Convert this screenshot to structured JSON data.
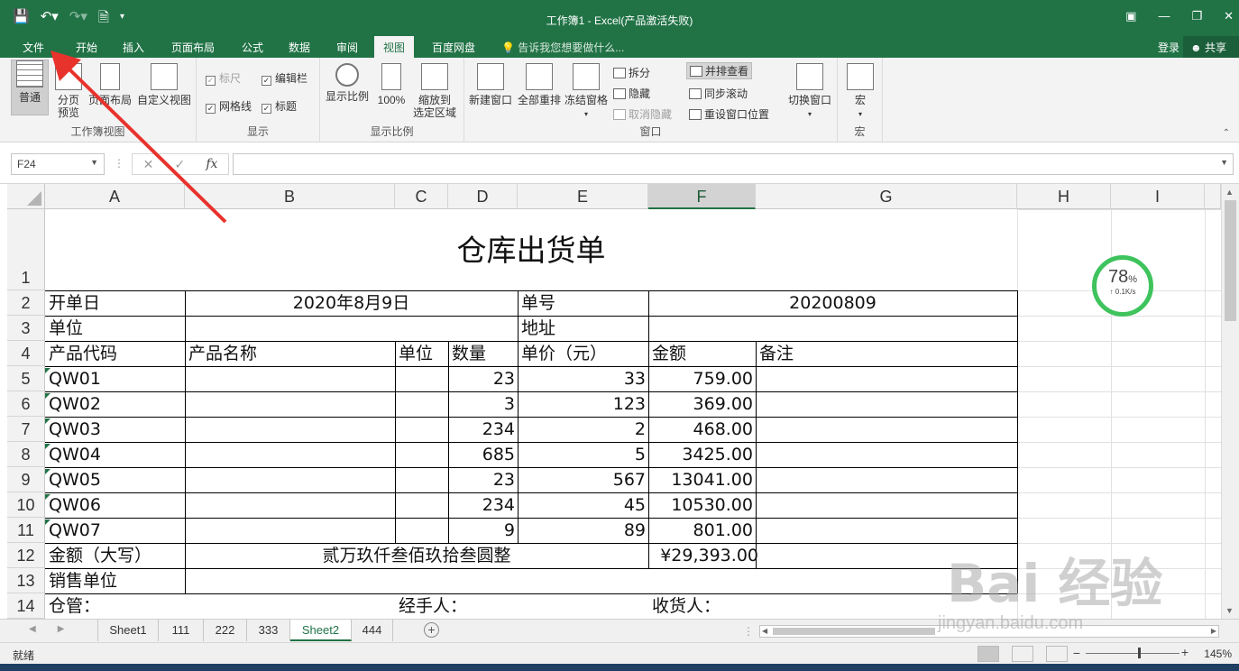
{
  "window": {
    "title": "工作簿1 - Excel(产品激活失败)"
  },
  "ribbon_tabs": [
    "文件",
    "开始",
    "插入",
    "页面布局",
    "公式",
    "数据",
    "审阅",
    "视图",
    "百度网盘"
  ],
  "tell_me": "告诉我您想要做什么...",
  "login": "登录",
  "share": "共享",
  "ribbon": {
    "workbook_views": {
      "normal": "普通",
      "page_break_1": "分页",
      "page_break_2": "预览",
      "page_layout": "页面布局",
      "custom_view": "自定义视图",
      "label": "工作簿视图"
    },
    "show": {
      "ruler": "标尺",
      "formula_bar": "编辑栏",
      "gridlines": "网格线",
      "headings": "标题",
      "label": "显示"
    },
    "zoom": {
      "zoom": "显示比例",
      "hundred": "100%",
      "zoom_sel_1": "缩放到",
      "zoom_sel_2": "选定区域",
      "label": "显示比例"
    },
    "window": {
      "new_window": "新建窗口",
      "arrange_all": "全部重排",
      "freeze": "冻结窗格",
      "split": "拆分",
      "hide": "隐藏",
      "unhide": "取消隐藏",
      "side_by_side": "并排查看",
      "sync_scroll": "同步滚动",
      "reset_pos": "重设窗口位置",
      "switch": "切换窗口",
      "label": "窗口"
    },
    "macros": {
      "macro": "宏",
      "label": "宏"
    }
  },
  "formula_bar": {
    "name_box": "F24",
    "fx": "fx",
    "value": ""
  },
  "columns": [
    "A",
    "B",
    "C",
    "D",
    "E",
    "F",
    "G",
    "H",
    "I"
  ],
  "rows": [
    "1",
    "2",
    "3",
    "4",
    "5",
    "6",
    "7",
    "8",
    "9",
    "10",
    "11",
    "12",
    "13",
    "14"
  ],
  "sheet": {
    "title": "仓库出货单",
    "date_label": "开单日",
    "date_value": "2020年8月9日",
    "order_label": "单号",
    "order_value": "20200809",
    "unit_label": "单位",
    "address_label": "地址",
    "headers": [
      "产品代码",
      "产品名称",
      "单位",
      "数量",
      "单价（元）",
      "金额",
      "备注"
    ],
    "items": [
      {
        "code": "QW01",
        "qty": "23",
        "price": "33",
        "amount": "759.00"
      },
      {
        "code": "QW02",
        "qty": "3",
        "price": "123",
        "amount": "369.00"
      },
      {
        "code": "QW03",
        "qty": "234",
        "price": "2",
        "amount": "468.00"
      },
      {
        "code": "QW04",
        "qty": "685",
        "price": "5",
        "amount": "3425.00"
      },
      {
        "code": "QW05",
        "qty": "23",
        "price": "567",
        "amount": "13041.00"
      },
      {
        "code": "QW06",
        "qty": "234",
        "price": "45",
        "amount": "10530.00"
      },
      {
        "code": "QW07",
        "qty": "9",
        "price": "89",
        "amount": "801.00"
      }
    ],
    "total_cn_label": "金额（大写）",
    "total_cn_value": "贰万玖仟叁佰玖拾叁圆整",
    "total_value": "¥29,393.00",
    "seller_label": "销售单位",
    "warehouse_label": "仓管：",
    "handler_label": "经手人：",
    "receiver_label": "收货人："
  },
  "speed_widget": {
    "percent": "78",
    "percent_sign": "%",
    "rate": "↑ 0.1K/s"
  },
  "sheet_tabs": [
    "Sheet1",
    "111",
    "222",
    "333",
    "Sheet2",
    "444"
  ],
  "active_sheet": "Sheet2",
  "status": {
    "ready": "就绪",
    "zoom_level": "145%",
    "minus": "−",
    "plus": "+"
  },
  "watermark": {
    "main": "Bai 经验",
    "sub": "jingyan.baidu.com"
  },
  "colors": {
    "excel_green": "#217346",
    "annotation_red": "#e8322c"
  }
}
